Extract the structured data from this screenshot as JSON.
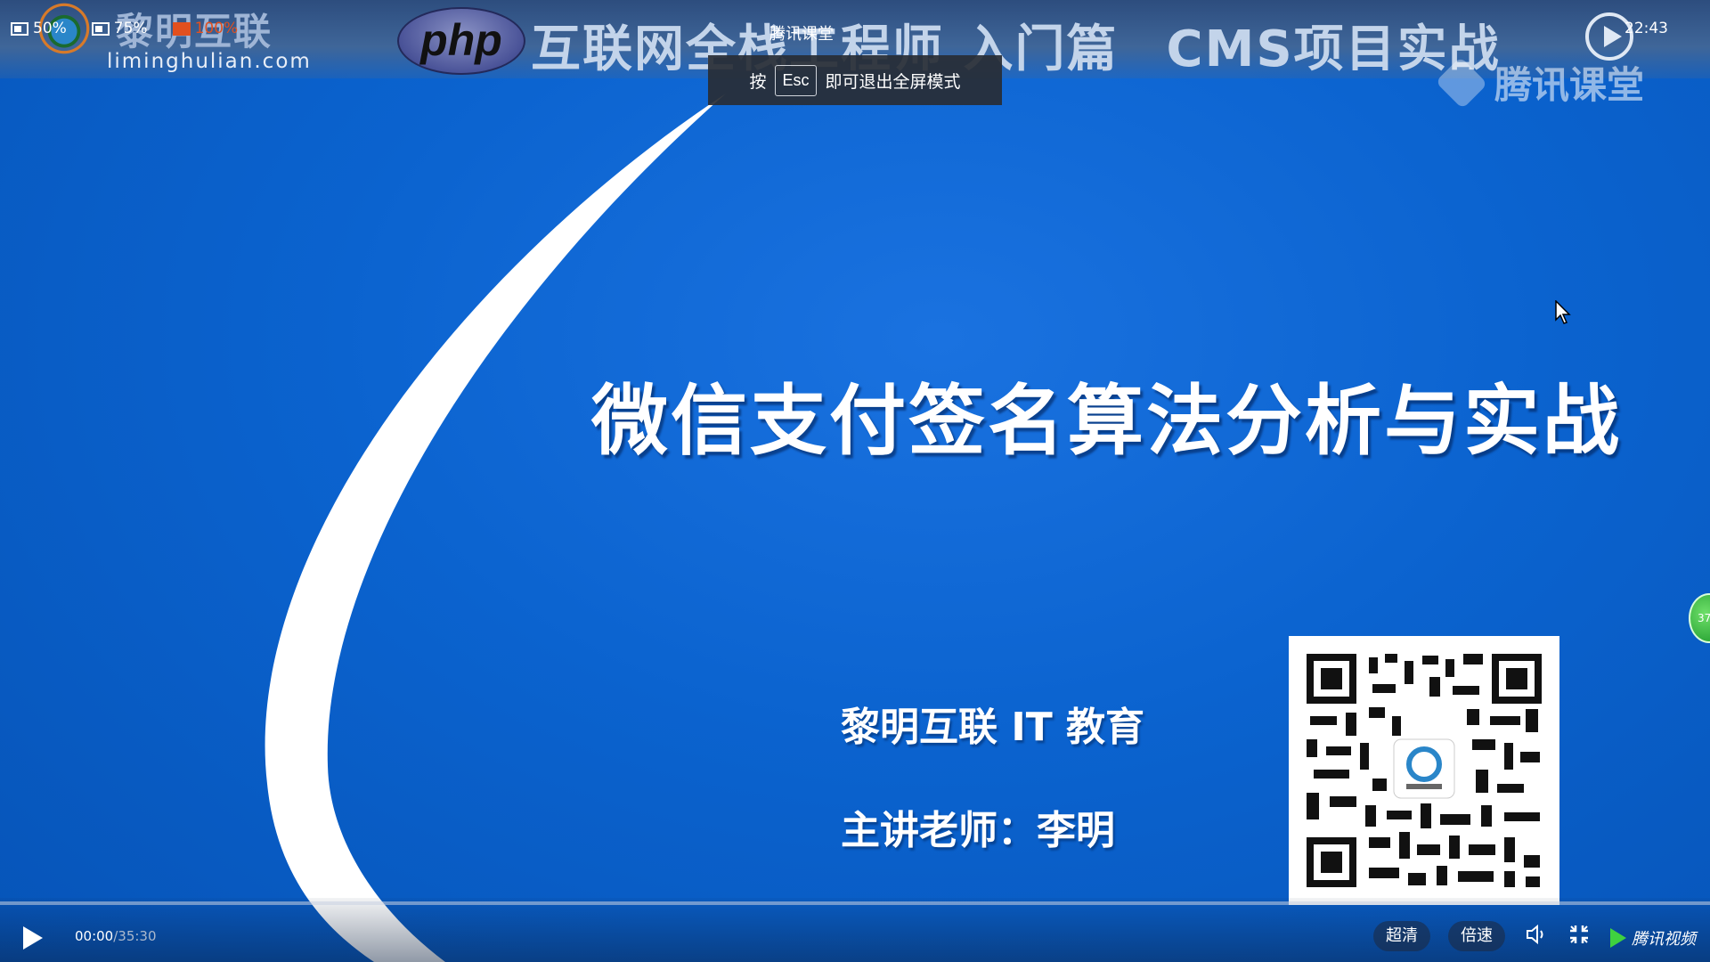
{
  "window": {
    "fullscreen_label": "腾讯课堂",
    "clock": "22:43"
  },
  "zoom": {
    "options": [
      "50%",
      "75%",
      "100%"
    ],
    "active": "100%"
  },
  "fullscreen_hint": {
    "prefix": "按",
    "key": "Esc",
    "suffix": "即可退出全屏模式"
  },
  "header": {
    "brand_cn": "黎明互联",
    "brand_url": "liminghulian.com",
    "php_logo": "php",
    "course_title_part1": "互联网全栈工程师 入门篇",
    "course_title_part2": "CMS项目实战",
    "watermark": "腾讯课堂"
  },
  "slide": {
    "title": "微信支付签名算法分析与实战",
    "org": "黎明互联 IT 教育",
    "teacher": "主讲老师：李明"
  },
  "side_badge": "37",
  "player": {
    "current_time": "00:00",
    "total_time": "/35:30",
    "progress": 0.0,
    "quality_label": "超清",
    "speed_label": "倍速",
    "brand": "腾讯视频"
  },
  "icons": [
    "play-icon",
    "volume-icon",
    "exit-fullscreen-icon",
    "tencent-video-logo-icon",
    "mouse-cursor-icon",
    "header-play-icon"
  ],
  "colors": {
    "background": "#0b63cf",
    "zoom_active": "#e2501e",
    "qr_bg": "#ffffff"
  }
}
